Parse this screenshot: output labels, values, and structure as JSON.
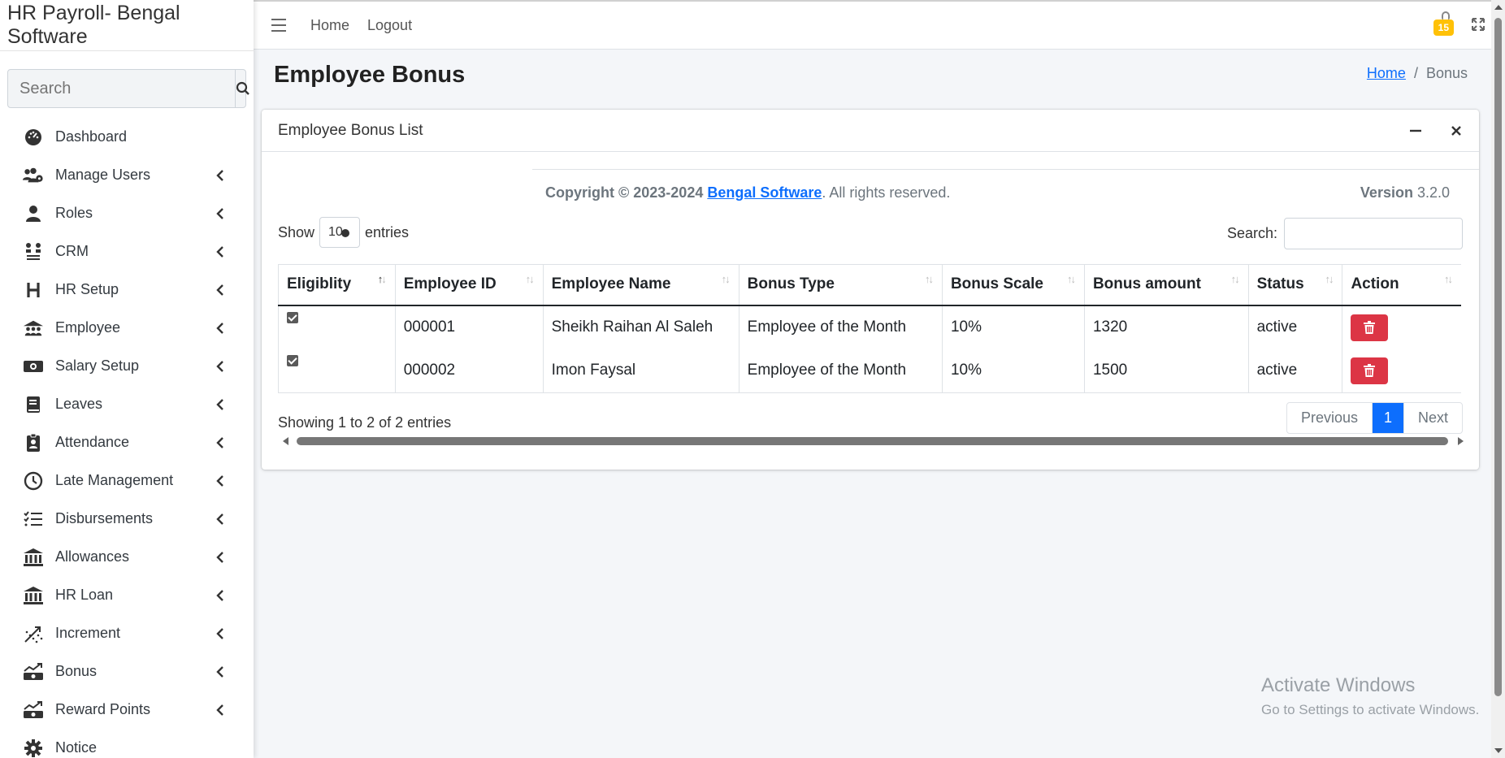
{
  "app": {
    "brand": "HR Payroll- Bengal Software"
  },
  "sidebar": {
    "search_placeholder": "Search",
    "items": [
      {
        "label": "Dashboard",
        "icon": "dashboard-icon",
        "has_children": false
      },
      {
        "label": "Manage Users",
        "icon": "users-cog-icon",
        "has_children": true
      },
      {
        "label": "Roles",
        "icon": "user-icon",
        "has_children": true
      },
      {
        "label": "CRM",
        "icon": "crm-icon",
        "has_children": true
      },
      {
        "label": "HR Setup",
        "icon": "h-icon",
        "has_children": true
      },
      {
        "label": "Employee",
        "icon": "employee-group-icon",
        "has_children": true
      },
      {
        "label": "Salary Setup",
        "icon": "money-icon",
        "has_children": true
      },
      {
        "label": "Leaves",
        "icon": "book-icon",
        "has_children": true
      },
      {
        "label": "Attendance",
        "icon": "id-badge-icon",
        "has_children": true
      },
      {
        "label": "Late Management",
        "icon": "clock-icon",
        "has_children": true
      },
      {
        "label": "Disbursements",
        "icon": "list-check-icon",
        "has_children": true
      },
      {
        "label": "Allowances",
        "icon": "bank-icon",
        "has_children": true
      },
      {
        "label": "HR Loan",
        "icon": "bank-icon",
        "has_children": true
      },
      {
        "label": "Increment",
        "icon": "increment-icon",
        "has_children": true
      },
      {
        "label": "Bonus",
        "icon": "chart-money-icon",
        "has_children": true
      },
      {
        "label": "Reward Points",
        "icon": "chart-money-icon",
        "has_children": true
      },
      {
        "label": "Notice",
        "icon": "gear-icon",
        "has_children": false
      }
    ]
  },
  "topbar": {
    "links": [
      "Home",
      "Logout"
    ],
    "notification_count": "15"
  },
  "page": {
    "title": "Employee Bonus",
    "breadcrumb": {
      "home": "Home",
      "sep": "/",
      "current": "Bonus"
    }
  },
  "card": {
    "title": "Employee Bonus List",
    "footer": {
      "copyright_prefix": "Copyright © 2023-2024 ",
      "company": "Bengal Software",
      "suffix": ". All rights reserved.",
      "version_label": "Version",
      "version": " 3.2.0"
    },
    "length": {
      "show": "Show",
      "value": "10",
      "entries": "entries"
    },
    "search_label": "Search:",
    "table": {
      "columns": [
        "Eligiblity",
        "Employee ID",
        "Employee Name",
        "Bonus Type",
        "Bonus Scale",
        "Bonus amount",
        "Status",
        "Action"
      ],
      "rows": [
        {
          "eligible": true,
          "employee_id": "000001",
          "name": "Sheikh Raihan Al Saleh",
          "bonus_type": "Employee of the Month",
          "scale": "10%",
          "amount": "1320",
          "status": "active"
        },
        {
          "eligible": true,
          "employee_id": "000002",
          "name": "Imon Faysal",
          "bonus_type": "Employee of the Month",
          "scale": "10%",
          "amount": "1500",
          "status": "active"
        }
      ]
    },
    "info": "Showing 1 to 2 of 2 entries",
    "pagination": {
      "previous": "Previous",
      "page": "1",
      "next": "Next"
    }
  },
  "watermark": {
    "line1": "Activate Windows",
    "line2": "Go to Settings to activate Windows."
  },
  "colors": {
    "primary": "#0d6efd",
    "danger": "#dc3545",
    "warning": "#ffc107"
  }
}
